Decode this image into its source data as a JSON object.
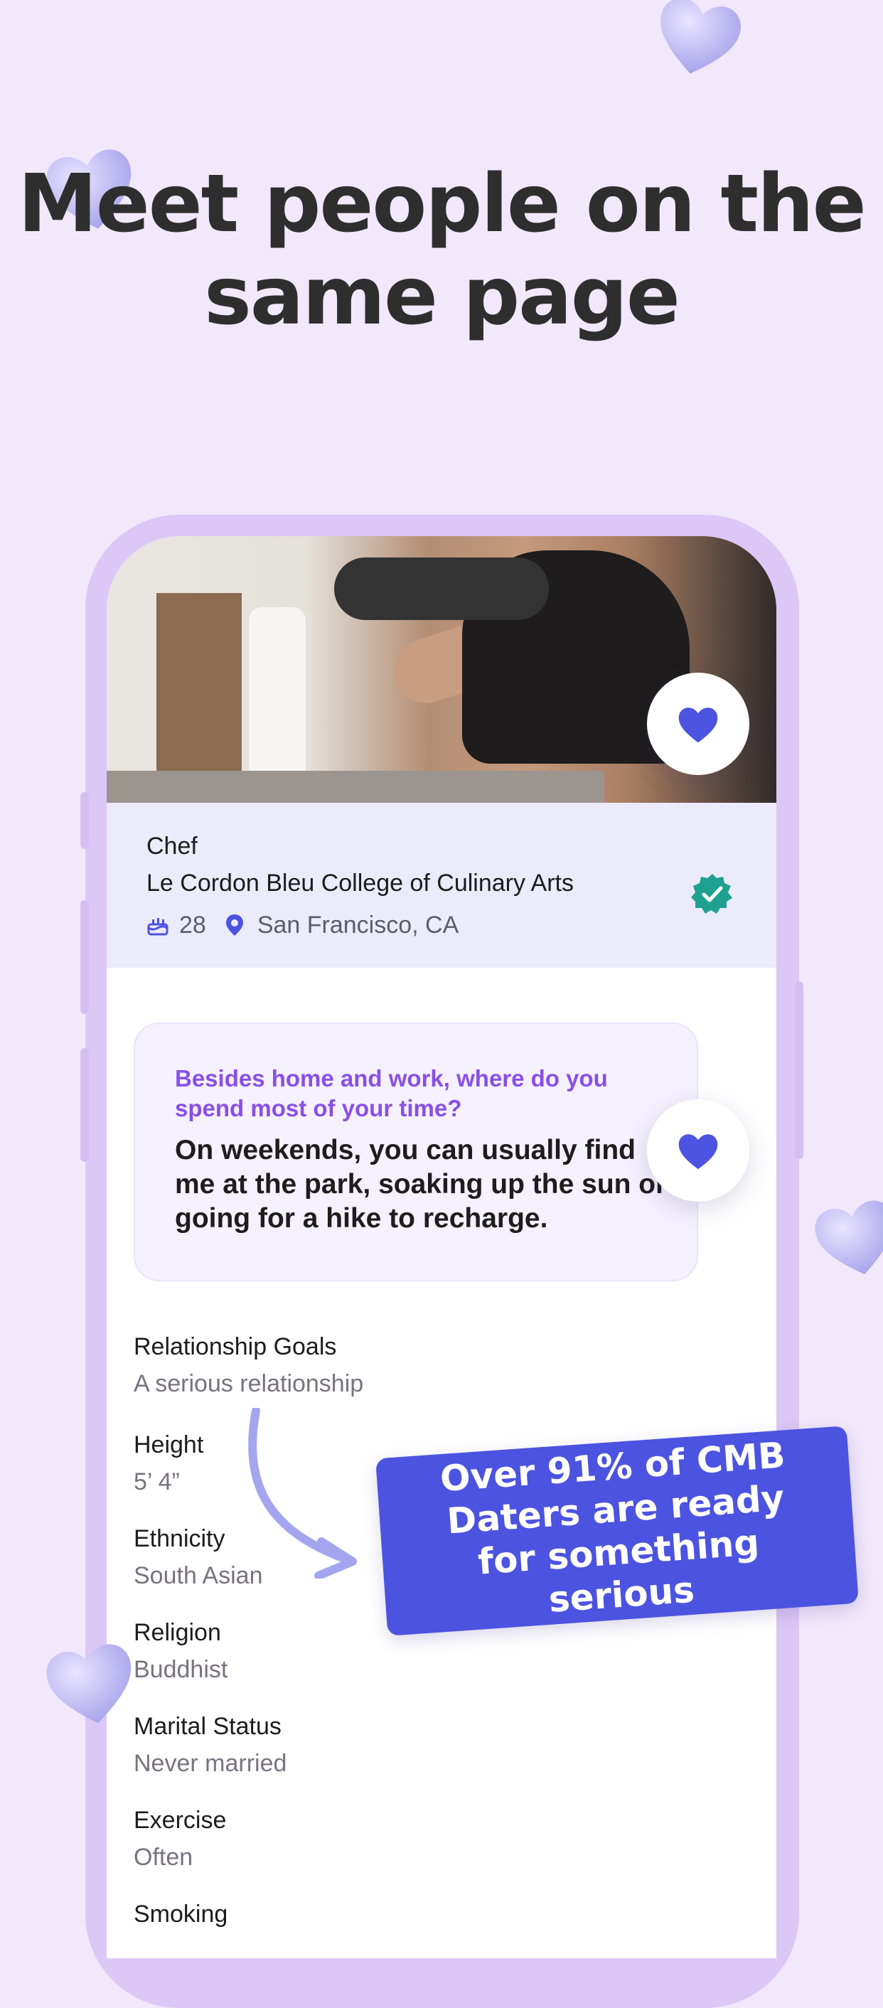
{
  "headline": "Meet people on the same page",
  "profile": {
    "job_title": "Chef",
    "school": "Le Cordon Bleu College of Culinary Arts",
    "age": "28",
    "location": "San Francisco, CA"
  },
  "prompt": {
    "question": "Besides home and work, where do you spend most of your time?",
    "answer": "On weekends, you can usually find me at the park, soaking up the sun or going for a hike to recharge."
  },
  "details": [
    {
      "label": "Relationship Goals",
      "value": "A serious relationship"
    },
    {
      "label": "Height",
      "value": "5’ 4”"
    },
    {
      "label": "Ethnicity",
      "value": "South Asian"
    },
    {
      "label": "Religion",
      "value": "Buddhist"
    },
    {
      "label": "Marital Status",
      "value": "Never married"
    },
    {
      "label": "Exercise",
      "value": "Often"
    },
    {
      "label": "Smoking",
      "value": ""
    }
  ],
  "callout": "Over 91% of CMB Daters are ready for something serious",
  "colors": {
    "background": "#f1e8fc",
    "phone_frame": "#dcc8f6",
    "accent_blue": "#4c53e0",
    "prompt_purple": "#8a4fe6",
    "verified_teal": "#1fa191",
    "info_panel": "#ecebfb"
  },
  "icons": [
    "heart-icon",
    "cake-icon",
    "location-pin-icon",
    "verified-badge-icon",
    "curved-arrow-icon",
    "decorative-heart-icon"
  ]
}
